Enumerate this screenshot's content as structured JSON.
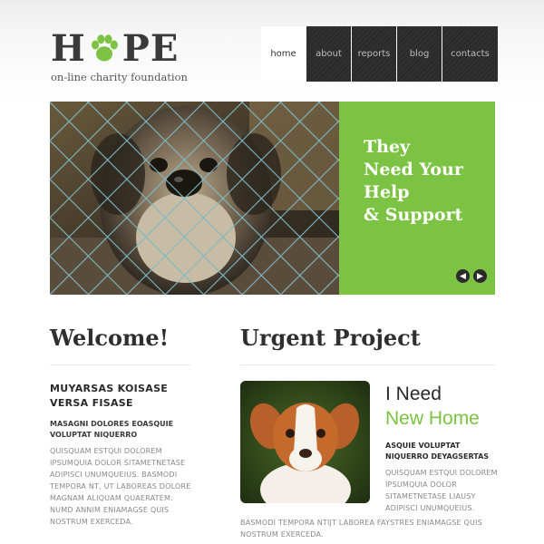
{
  "logo": {
    "letter_h": "H",
    "letters_pe": "PE",
    "tagline": "on-line charity foundation",
    "paw_color": "#7cc243"
  },
  "nav": {
    "items": [
      {
        "label": "home",
        "active": true
      },
      {
        "label": "about"
      },
      {
        "label": "reports"
      },
      {
        "label": "blog"
      },
      {
        "label": "contacts"
      }
    ]
  },
  "hero": {
    "line1": "They",
    "line2": "Need Your",
    "line3": "Help",
    "line4": "& Support",
    "accent": "#7cc243",
    "prev_icon": "arrow-left-icon",
    "next_icon": "arrow-right-icon"
  },
  "welcome": {
    "title": "Welcome!",
    "subtitle": "MUYARSAS KOISASE VERSA FISASE",
    "lead": "MASAGNI DOLORES EOASQUIE VOLUPTAT NIQUERRO",
    "body": "QUISQUAM ESTQUI DOLOREM IPSUMQUIA DOLOR SITAMETNETASE ADIPISCI UNUMQUEIUS. BASMODI TEMPORA NT, UT LABOREAS DOLORE MAGNAM ALIQUAM QUAERATEM. NUMD ANNIM ENIAMAGSE QUIS NOSTRUM EXERCEDA."
  },
  "urgent": {
    "title": "Urgent Project",
    "heading_line1": "I Need",
    "heading_line2": "New Home",
    "lead": "ASQUIE VOLUPTAT NIQUERRO DEYAGSERTAS",
    "body": "QUISQUAM ESTQUI DOLOREM IPSUMQUIA DOLOR SITAMETNETASE LIAUSY ADIPISCI UNUMQUEIUS.",
    "body_bottom": "BASMODI TEMPORA NTIJT LABOREA FAYSTRES ENIAMAGSE QUIS NOSTRUM EXERCEDA."
  }
}
